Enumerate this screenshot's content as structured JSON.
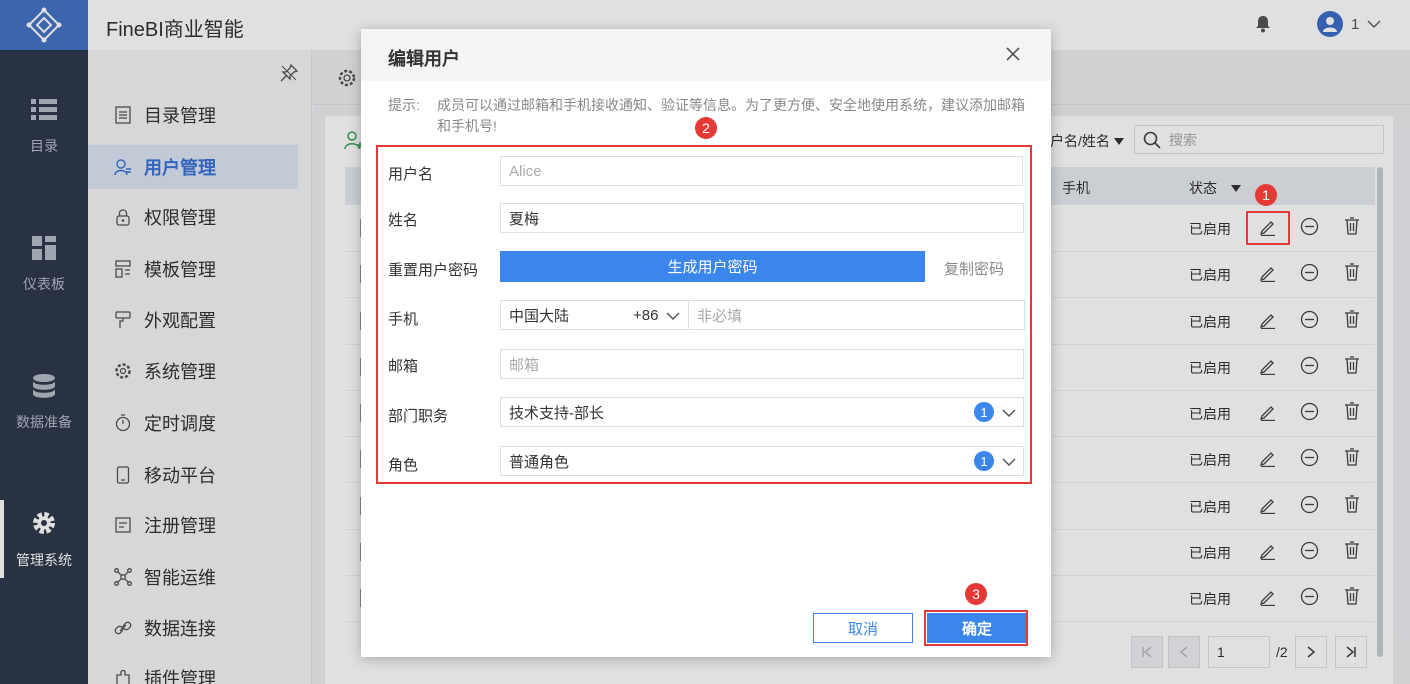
{
  "header": {
    "app_title": "FineBI商业智能",
    "user_count": "1"
  },
  "leftnav": {
    "items": [
      {
        "label": "目录",
        "icon": "list-icon"
      },
      {
        "label": "仪表板",
        "icon": "dashboard-icon"
      },
      {
        "label": "数据准备",
        "icon": "database-icon"
      },
      {
        "label": "管理系统",
        "icon": "gear-icon",
        "active": true
      }
    ]
  },
  "sidebar": {
    "items": [
      {
        "label": "目录管理",
        "icon": "directory-icon"
      },
      {
        "label": "用户管理",
        "icon": "user-icon",
        "active": true
      },
      {
        "label": "权限管理",
        "icon": "lock-icon"
      },
      {
        "label": "模板管理",
        "icon": "template-icon"
      },
      {
        "label": "外观配置",
        "icon": "paint-icon"
      },
      {
        "label": "系统管理",
        "icon": "settings-icon"
      },
      {
        "label": "定时调度",
        "icon": "timer-icon"
      },
      {
        "label": "移动平台",
        "icon": "mobile-icon"
      },
      {
        "label": "注册管理",
        "icon": "register-icon"
      },
      {
        "label": "智能运维",
        "icon": "ops-icon"
      },
      {
        "label": "数据连接",
        "icon": "link-icon"
      },
      {
        "label": "插件管理",
        "icon": "plugin-icon"
      }
    ]
  },
  "table": {
    "filter_label": "户名/姓名",
    "search_placeholder": "搜索",
    "col_phone": "手机",
    "col_status": "状态",
    "rows": [
      "已启用",
      "已启用",
      "已启用",
      "已启用",
      "已启用",
      "已启用",
      "已启用",
      "已启用",
      "已启用"
    ],
    "page_input": "1",
    "page_total": "/2"
  },
  "dialog": {
    "title": "编辑用户",
    "tip_label": "提示:",
    "tip_text": "成员可以通过邮箱和手机接收通知、验证等信息。为了更方便、安全地使用系统，建议添加邮箱和手机号!",
    "username_label": "用户名",
    "username_value": "Alice",
    "name_label": "姓名",
    "name_value": "夏梅",
    "password_label": "重置用户密码",
    "generate_password": "生成用户密码",
    "copy_password": "复制密码",
    "phone_label": "手机",
    "phone_region": "中国大陆",
    "phone_code": "+86",
    "phone_placeholder": "非必填",
    "email_label": "邮箱",
    "email_placeholder": "邮箱",
    "dept_label": "部门职务",
    "dept_value": "技术支持-部长",
    "dept_count": "1",
    "role_label": "角色",
    "role_value": "普通角色",
    "role_count": "1",
    "cancel": "取消",
    "confirm": "确定"
  },
  "annotations": {
    "marker1": "1",
    "marker2": "2",
    "marker3": "3"
  },
  "colors": {
    "accent": "#3b86ea",
    "nav_bg": "#2e3a4d",
    "marker": "#e53935"
  }
}
